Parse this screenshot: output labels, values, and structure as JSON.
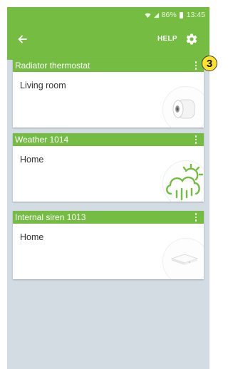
{
  "status_bar": {
    "battery": "86%",
    "time": "13:45",
    "icons": [
      "wifi-icon",
      "signal-icon",
      "battery-icon"
    ]
  },
  "app_bar": {
    "back_icon": "arrow-left-icon",
    "help_label": "HELP",
    "settings_icon": "gear-icon"
  },
  "devices": [
    {
      "title": "Radiator thermostat",
      "location": "Living room",
      "image": "radiator-thermostat-image"
    },
    {
      "title": "Weather 1014",
      "location": "Home",
      "image": "weather-cloud-sun-rain-icon"
    },
    {
      "title": "Internal siren 1013",
      "location": "Home",
      "image": "internal-siren-image"
    }
  ],
  "annotation": {
    "badge": "3"
  },
  "colors": {
    "accent": "#74bd42",
    "background": "#d3dbe3",
    "card": "#ffffff",
    "badge": "#ffe22a"
  }
}
